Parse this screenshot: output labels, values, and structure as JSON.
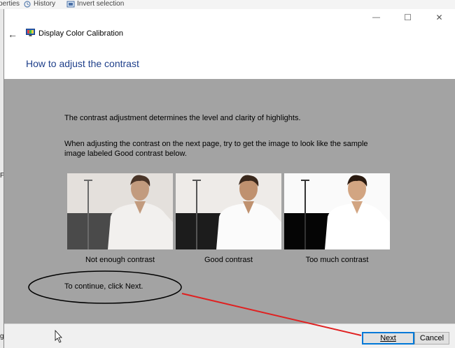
{
  "background": {
    "toolbar_items": [
      {
        "label": "History",
        "icon": "history-icon"
      },
      {
        "label": "Invert selection",
        "icon": "invert-selection-icon"
      }
    ],
    "left_fragment_top": "perties",
    "left_fragment_mid": "Pa",
    "left_fragment_bottom": "g"
  },
  "window": {
    "caption": {
      "minimize": "—",
      "maximize": "☐",
      "close": "✕"
    },
    "back_glyph": "←",
    "title": "Display Color Calibration",
    "heading": "How to adjust the contrast"
  },
  "content": {
    "para1": "The contrast adjustment determines the level and clarity of highlights.",
    "para2": "When adjusting the contrast on the next page, try to get the image to look like the sample image labeled Good contrast below.",
    "samples": [
      {
        "caption": "Not enough contrast"
      },
      {
        "caption": "Good contrast"
      },
      {
        "caption": "Too much contrast"
      }
    ],
    "continue_text": "To continue, click Next."
  },
  "footer": {
    "next_label": "Next",
    "cancel_label": "Cancel"
  },
  "colors": {
    "heading": "#1e3f8a",
    "panel_gray": "#a3a3a3",
    "annotation_red": "#e02020",
    "annotation_ellipse": "#000000",
    "focus_blue": "#0078d7"
  }
}
